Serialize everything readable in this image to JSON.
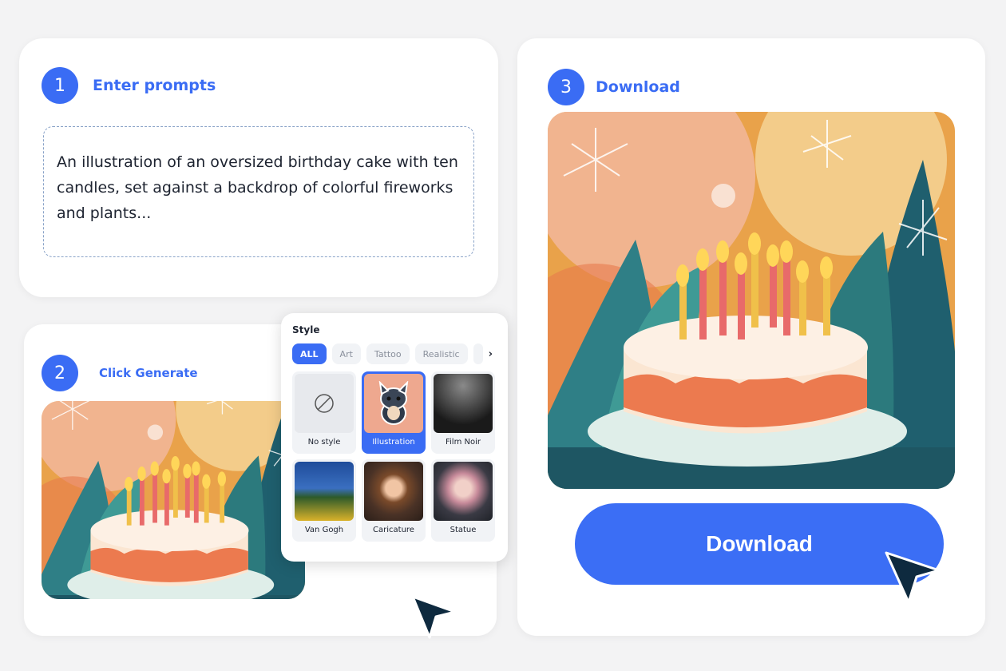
{
  "step1": {
    "number": "1",
    "label": "Enter prompts",
    "prompt": "An illustration of an oversized birthday cake with ten candles, set against a backdrop of colorful fireworks and plants..."
  },
  "step2": {
    "number": "2",
    "label": "Click Generate"
  },
  "step3": {
    "number": "3",
    "label": "Download",
    "button": "Download"
  },
  "style_panel": {
    "title": "Style",
    "chips": [
      {
        "label": "ALL",
        "active": true
      },
      {
        "label": "Art"
      },
      {
        "label": "Tattoo"
      },
      {
        "label": "Realistic"
      }
    ],
    "styles": [
      {
        "label": "No style",
        "icon": "no-style-icon"
      },
      {
        "label": "Illustration",
        "selected": true
      },
      {
        "label": "Film Noir"
      },
      {
        "label": "Van Gogh"
      },
      {
        "label": "Caricature"
      },
      {
        "label": "Statue"
      }
    ]
  },
  "colors": {
    "accent": "#3a6cf4",
    "button": "#3b6ef5",
    "cursor": "#0e2a3f"
  }
}
